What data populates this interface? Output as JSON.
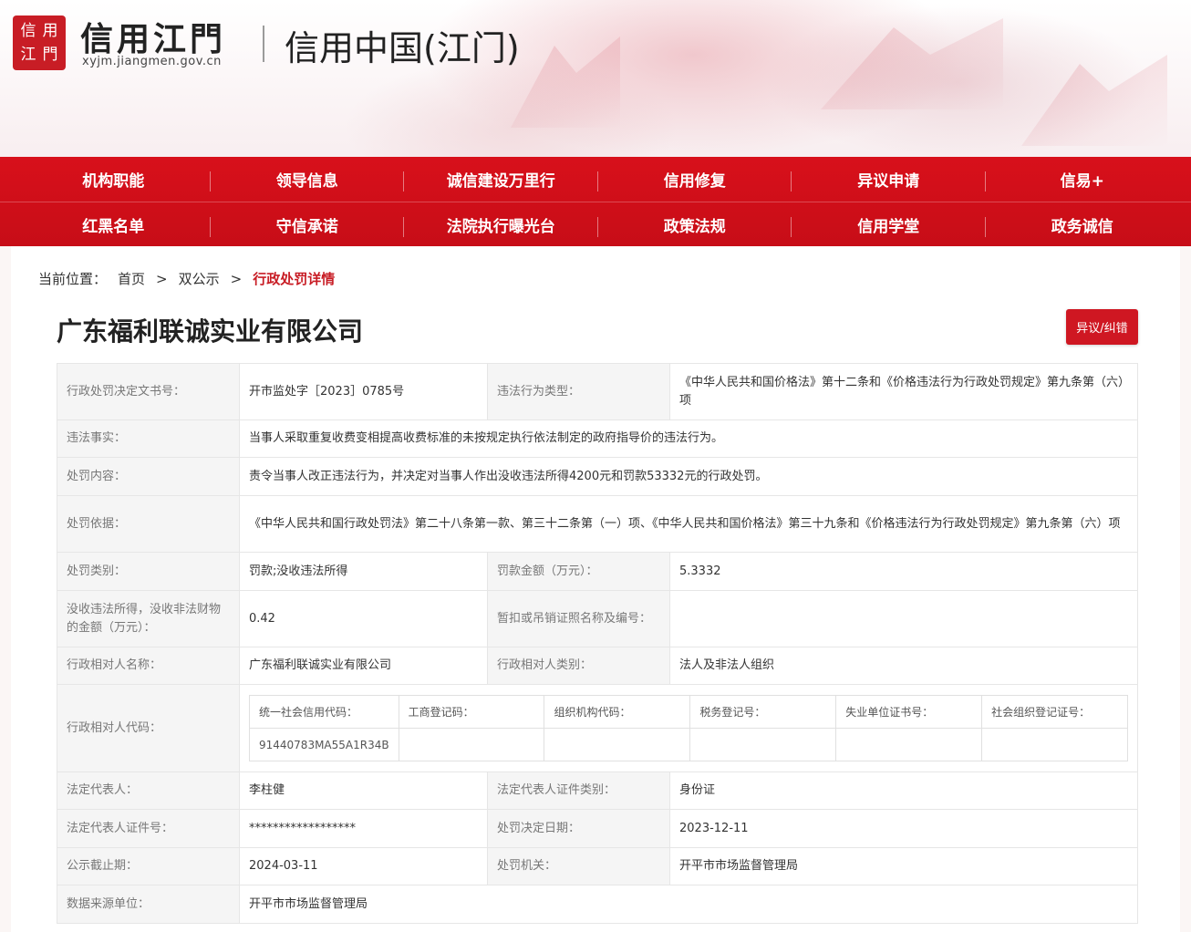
{
  "header": {
    "seal_chars": [
      "信",
      "用",
      "江",
      "門"
    ],
    "brand_name": "信用江門",
    "brand_url": "xyjm.jiangmen.gov.cn",
    "site_title": "信用中国(江门)"
  },
  "nav": {
    "row1": [
      "机构职能",
      "领导信息",
      "诚信建设万里行",
      "信用修复",
      "异议申请",
      "信易+"
    ],
    "row2": [
      "红黑名单",
      "守信承诺",
      "法院执行曝光台",
      "政策法规",
      "信用学堂",
      "政务诚信"
    ]
  },
  "breadcrumb": {
    "label": "当前位置：",
    "home": "首页",
    "sep": ">",
    "section": "双公示",
    "current": "行政处罚详情"
  },
  "company": {
    "name": "广东福利联诚实业有限公司",
    "objection_button": "异议/纠错"
  },
  "details": {
    "decision_no_label": "行政处罚决定文书号：",
    "decision_no": "开市监处字［2023］0785号",
    "violation_type_label": "违法行为类型：",
    "violation_type": "《中华人民共和国价格法》第十二条和《价格违法行为行政处罚规定》第九条第（六）项",
    "facts_label": "违法事实：",
    "facts": "当事人采取重复收费变相提高收费标准的未按规定执行依法制定的政府指导价的违法行为。",
    "content_label": "处罚内容：",
    "content": "责令当事人改正违法行为，并决定对当事人作出没收违法所得4200元和罚款53332元的行政处罚。",
    "basis_label": "处罚依据：",
    "basis": "《中华人民共和国行政处罚法》第二十八条第一款、第三十二条第（一）项、《中华人民共和国价格法》第三十九条和《价格违法行为行政处罚规定》第九条第（六）项",
    "category_label": "处罚类别：",
    "category": "罚款;没收违法所得",
    "fine_label": "罚款金额（万元）：",
    "fine": "5.3332",
    "confiscated_label": "没收违法所得，没收非法财物的金额（万元）：",
    "confiscated": "0.42",
    "license_label": "暂扣或吊销证照名称及编号：",
    "license": "",
    "party_name_label": "行政相对人名称：",
    "party_name": "广东福利联诚实业有限公司",
    "party_type_label": "行政相对人类别：",
    "party_type": "法人及非法人组织",
    "party_code_label": "行政相对人代码：",
    "codes_headers": [
      "统一社会信用代码：",
      "工商登记码：",
      "组织机构代码：",
      "税务登记号：",
      "失业单位证书号：",
      "社会组织登记证号："
    ],
    "codes_values": [
      "91440783MA55A1R34B",
      "",
      "",
      "",
      "",
      ""
    ],
    "legal_rep_label": "法定代表人：",
    "legal_rep": "李柱健",
    "legal_rep_id_type_label": "法定代表人证件类别：",
    "legal_rep_id_type": "身份证",
    "legal_rep_id_no_label": "法定代表人证件号：",
    "legal_rep_id_no": "******************",
    "decision_date_label": "处罚决定日期：",
    "decision_date": "2023-12-11",
    "publish_deadline_label": "公示截止期：",
    "publish_deadline": "2024-03-11",
    "authority_label": "处罚机关：",
    "authority": "开平市市场监督管理局",
    "source_label": "数据来源单位：",
    "source": "开平市市场监督管理局"
  },
  "colors": {
    "brand_red": "#d8101b",
    "accent_red": "#c81d25",
    "label_bg": "#f5f5f5"
  }
}
